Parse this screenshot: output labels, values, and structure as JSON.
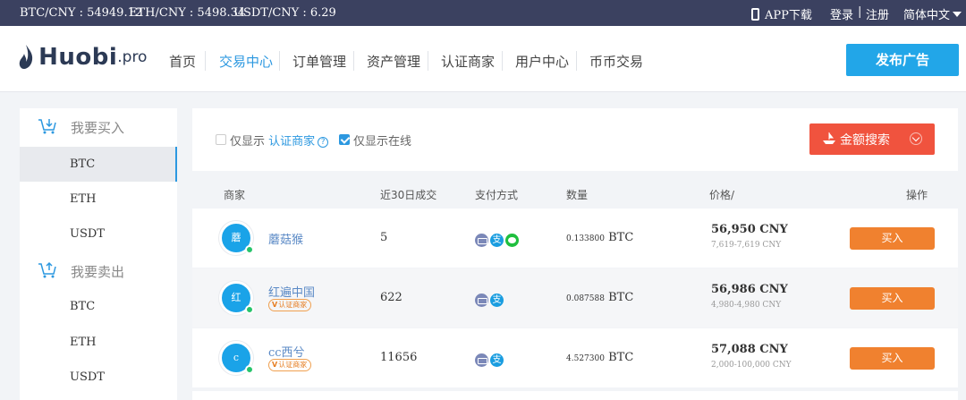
{
  "ticker": {
    "btc": "BTC/CNY : 54949.12",
    "eth": "ETH/CNY : 5498.34",
    "usdt": "USDT/CNY : 6.29",
    "app": "APP下载",
    "login": "登录",
    "sep": "|",
    "register": "注册",
    "language": "简体中文"
  },
  "logo": {
    "main": "Huobi",
    "suffix": ".pro"
  },
  "nav": {
    "items": [
      "首页",
      "交易中心",
      "订单管理",
      "资产管理",
      "认证商家",
      "用户中心",
      "币币交易"
    ],
    "active_index": 1,
    "publish": "发布广告"
  },
  "sidebar": {
    "buy_title": "我要买入",
    "sell_title": "我要卖出",
    "buy_coins": [
      "BTC",
      "ETH",
      "USDT"
    ],
    "sell_coins": [
      "BTC",
      "ETH",
      "USDT"
    ],
    "active": "BTC (buy)"
  },
  "filters": {
    "only_show": "仅显示",
    "certified_link": "认证商家",
    "certified_checked": false,
    "online_label": "仅显示在线",
    "online_checked": true,
    "amount_search": "金额搜索"
  },
  "table": {
    "headers": {
      "merchant": "商家",
      "trades_30d": "近30日成交",
      "payment": "支付方式",
      "quantity": "数量",
      "price": "价格/",
      "action": "操作"
    },
    "rows": [
      {
        "avatar": "蘑",
        "name": "蘑菇猴",
        "certified": false,
        "trades": "5",
        "payments": [
          "bank-card",
          "alipay",
          "wechat"
        ],
        "qty_num": "0.133800",
        "qty_unit": "BTC",
        "price": "56,950 CNY",
        "limit": "7,619-7,619 CNY",
        "buy": "买入"
      },
      {
        "avatar": "红",
        "name": "红遍中国",
        "certified": true,
        "badge": "认证商家",
        "trades": "622",
        "payments": [
          "bank-card",
          "alipay"
        ],
        "qty_num": "0.087588",
        "qty_unit": "BTC",
        "price": "56,986 CNY",
        "limit": "4,980-4,980 CNY",
        "buy": "买入"
      },
      {
        "avatar": "c",
        "name": "cc西兮",
        "certified": true,
        "badge": "认证商家",
        "trades": "11656",
        "payments": [
          "bank-card",
          "alipay"
        ],
        "qty_num": "4.527300",
        "qty_unit": "BTC",
        "price": "57,088 CNY",
        "limit": "2,000-100,000 CNY",
        "buy": "买入"
      }
    ]
  },
  "badge_v": "V",
  "help_glyph": "?",
  "alipay_glyph": "支",
  "colors": {
    "ticker_bg": "#3b4160",
    "accent": "#2c98e0",
    "publish_bg": "#22a6e8",
    "search_btn": "#f0533e",
    "buy_btn": "#f0812f",
    "online": "#27c46b",
    "badge": "#e67e22"
  }
}
